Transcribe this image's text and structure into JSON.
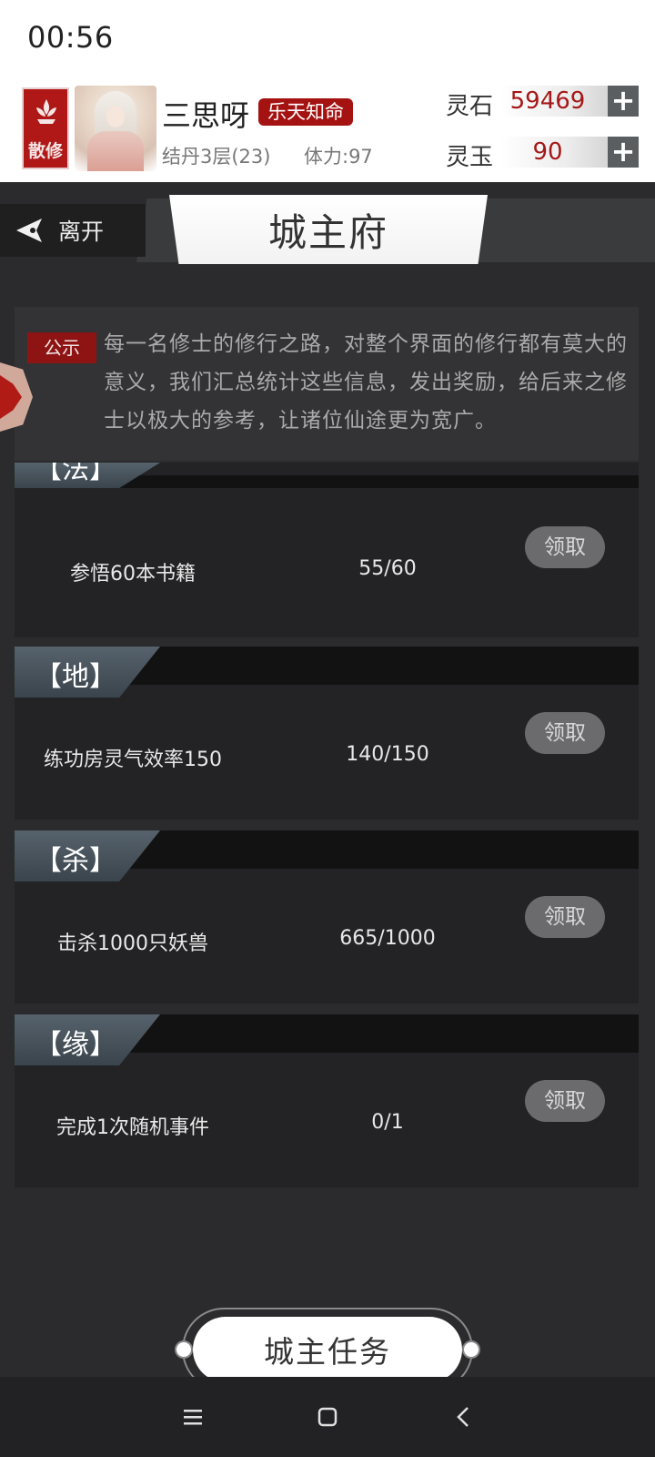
{
  "status_bar": {
    "time": "00:56"
  },
  "player": {
    "sect": "散修",
    "name": "三思呀",
    "title": "乐天知命",
    "realm": "结丹3层(23)",
    "stamina": "体力:97"
  },
  "currencies": [
    {
      "label": "灵石",
      "value": "59469",
      "icon": "plus-icon"
    },
    {
      "label": "灵玉",
      "value": "90",
      "icon": "plus-icon"
    }
  ],
  "nav": {
    "back_label": "离开",
    "page_title": "城主府"
  },
  "notice": {
    "tag": "公示",
    "text": "每一名修士的修行之路，对整个界面的修行都有莫大的意义，我们汇总统计这些信息，发出奖励，给后来之修士以极大的参考，让诸位仙途更为宽广。"
  },
  "tasks": [
    {
      "tab": "【法】",
      "description": "参悟60本书籍",
      "progress": "55/60",
      "button": "领取"
    },
    {
      "tab": "【地】",
      "description": "练功房灵气效率150",
      "progress": "140/150",
      "button": "领取"
    },
    {
      "tab": "【杀】",
      "description": "击杀1000只妖兽",
      "progress": "665/1000",
      "button": "领取"
    },
    {
      "tab": "【缘】",
      "description": "完成1次随机事件",
      "progress": "0/1",
      "button": "领取"
    }
  ],
  "bottom_button": "城主任务",
  "colors": {
    "accent_red": "#a51212",
    "panel": "#232325",
    "header": "#121213"
  }
}
